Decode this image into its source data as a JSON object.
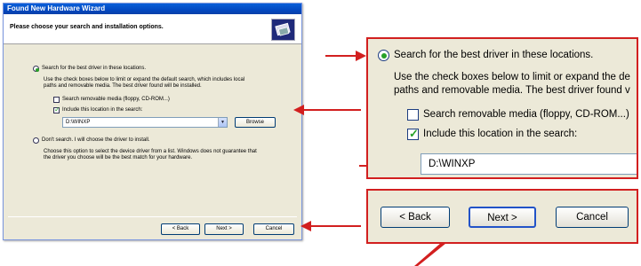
{
  "wizard": {
    "title": "Found New Hardware Wizard",
    "header": "Please choose your search and installation options.",
    "search_option": "Search for the best driver in these locations.",
    "search_desc_line1": "Use the check boxes below to limit or expand the default search, which includes local",
    "search_desc_line2": "paths and removable media. The best driver found will be installed.",
    "removable_media": "Search removable media (floppy, CD-ROM...)",
    "include_location": "Include this location in the search:",
    "location_value": "D:\\WINXP",
    "browse": "Browse",
    "dont_search": "Don't search. I will choose the driver to install.",
    "dont_search_desc_line1": "Choose this option to select the device driver from a list. Windows does not guarantee that",
    "dont_search_desc_line2": "the driver you choose will be the best match for your hardware.",
    "back": "< Back",
    "next": "Next >",
    "cancel": "Cancel"
  },
  "zoom_options": {
    "search_option": "Search for the best driver in these locations.",
    "desc_line1": "Use the check boxes below to limit or expand the de",
    "desc_line2": "paths and removable media. The best driver found v",
    "removable_media": "Search removable media (floppy, CD-ROM...)",
    "include_location": "Include this location in the search:",
    "location_value": "D:\\WINXP"
  },
  "zoom_buttons": {
    "back": "< Back",
    "next": "Next >",
    "cancel": "Cancel"
  },
  "colors": {
    "annotation_red": "#d21f1f",
    "xp_titlebar": "#0a5fd8",
    "dialog_bg": "#ece9d8"
  }
}
